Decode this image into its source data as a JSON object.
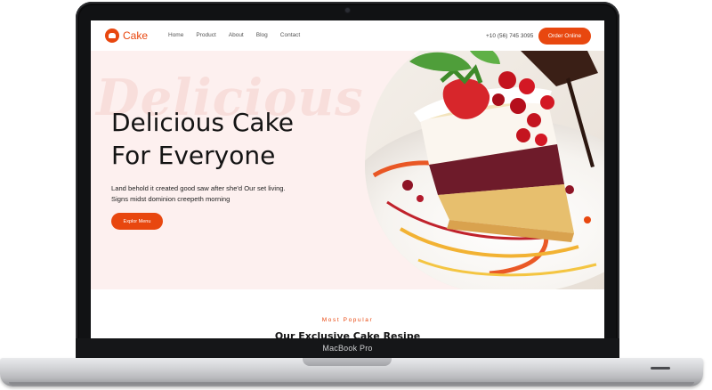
{
  "device": {
    "label": "MacBook Pro"
  },
  "site": {
    "logo_text": "Cake",
    "nav": [
      {
        "label": "Home"
      },
      {
        "label": "Product"
      },
      {
        "label": "About"
      },
      {
        "label": "Blog"
      },
      {
        "label": "Contact"
      }
    ],
    "phone": "+10 (56) 745 3095",
    "cta_label": "Order Online",
    "accent_color": "#e8470f"
  },
  "hero": {
    "watermark": "Delicious",
    "headline_line1": "Delicious Cake",
    "headline_line2": "For Everyone",
    "description_line1": "Land behold it created good saw after she'd Our set living.",
    "description_line2": "Signs midst dominion creepeth morning",
    "button_label": "Explor Menu"
  },
  "section": {
    "eyebrow": "Most Popular",
    "title": "Our Exclusive Cake Resipe"
  }
}
